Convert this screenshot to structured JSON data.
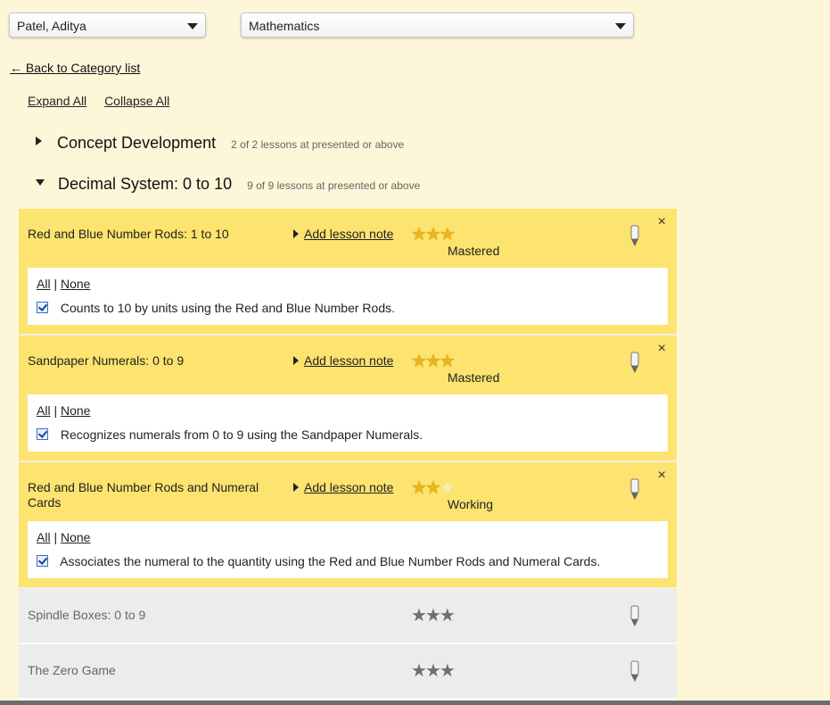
{
  "student_select": {
    "value": "Patel, Aditya"
  },
  "subject_select": {
    "value": "Mathematics"
  },
  "back_link": "← Back to Category list",
  "expand_all": "Expand All",
  "collapse_all": "Collapse All",
  "categories": [
    {
      "name": "Concept Development",
      "count": "2 of 2 lessons at presented or above",
      "expanded": false
    },
    {
      "name": "Decimal System: 0 to 10",
      "count": "9 of 9 lessons at presented or above",
      "expanded": true
    }
  ],
  "add_note_label": "Add lesson note",
  "all_label": "All",
  "separator": "|",
  "none_label": "None",
  "close_glyph": "×",
  "colors": {
    "active": "#fde36f",
    "inactive": "#ececec",
    "star_gold": "#f0b21a",
    "star_grey": "#6f6f6f"
  },
  "lessons": [
    {
      "title": "Red and Blue Number Rods: 1 to 10",
      "stars": 3,
      "status": "Mastered",
      "objective": "Counts to 10 by units using the Red and Blue Number Rods."
    },
    {
      "title": "Sandpaper Numerals: 0 to 9",
      "stars": 3,
      "status": "Mastered",
      "objective": "Recognizes numerals from 0 to 9 using the Sandpaper Numerals."
    },
    {
      "title": "Red and Blue Number Rods and Numeral Cards",
      "stars": 2,
      "status": "Working",
      "objective": "Associates the numeral to the quantity using the Red and Blue Number Rods and Numeral Cards."
    },
    {
      "title": "Spindle Boxes: 0 to 9",
      "stars": 0,
      "status": ""
    },
    {
      "title": "The Zero Game",
      "stars": 0,
      "status": ""
    }
  ]
}
